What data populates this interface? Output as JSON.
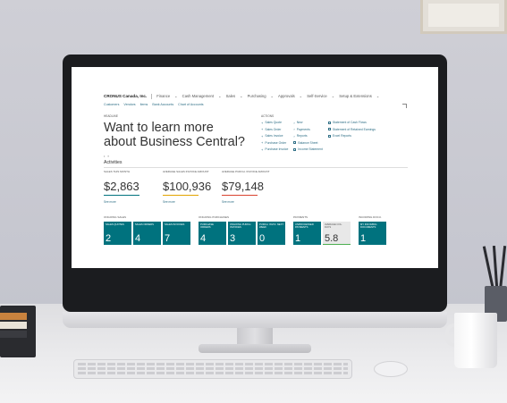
{
  "app": {
    "company": "CRONUS Canada, Inc.",
    "nav": [
      "Finance",
      "Cash Management",
      "Sales",
      "Purchasing",
      "Approvals",
      "Self-Service",
      "Setup & Extensions"
    ],
    "subnav": [
      "Customers",
      "Vendors",
      "Items",
      "Bank Accounts",
      "Chart of Accounts"
    ],
    "headline_label": "HEADLINE",
    "headline": "Want to learn more about Business Central?",
    "actions_label": "ACTIONS",
    "actions": {
      "col1": [
        "Sales Quote",
        "Sales Order",
        "Sales Invoice",
        "Purchase Order",
        "Purchase Invoice"
      ],
      "col2": [
        "New",
        "Payments",
        "Reports",
        "Balance Sheet",
        "Income Statement"
      ],
      "col3": [
        "Statement of Cash Flows",
        "Statement of Retained Earnings",
        "Excel Reports"
      ]
    },
    "activities_title": "Activities",
    "kpis": [
      {
        "label": "SALES THIS MONTH",
        "value": "$2,863",
        "more": "See more",
        "bar_color": "#00727e"
      },
      {
        "label": "AVERAGE SALES INVOICE AMOUNT",
        "value": "$100,936",
        "more": "See more",
        "bar_color": "#e2a400"
      },
      {
        "label": "AVERAGE PURCH. INVOICE AMOUNT",
        "value": "$79,148",
        "more": "See more",
        "bar_color": "#d9432f"
      }
    ],
    "groups": [
      {
        "label": "ONGOING SALES",
        "tiles": [
          {
            "label": "SALES QUOTES",
            "value": "2"
          },
          {
            "label": "SALES ORDERS",
            "value": "4"
          },
          {
            "label": "SALES INVOICES",
            "value": "7"
          }
        ]
      },
      {
        "label": "ONGOING PURCHASES",
        "tiles": [
          {
            "label": "PURCHASE ORDERS",
            "value": "4"
          },
          {
            "label": "ONGOING PURCH. INVOICES",
            "value": "3"
          },
          {
            "label": "PURCH. INVOI. NEXT WEEK",
            "value": "0"
          }
        ]
      },
      {
        "label": "PAYMENTS",
        "tiles": [
          {
            "label": "UNPROCESSED PAYMENTS",
            "value": "1"
          },
          {
            "label": "AVERAGE COL. DAYS",
            "value": "5.8"
          }
        ]
      },
      {
        "label": "INCOMING DOCU.",
        "tiles": [
          {
            "label": "MY INCOMING DOCUMENTS",
            "value": "1"
          }
        ]
      }
    ]
  }
}
